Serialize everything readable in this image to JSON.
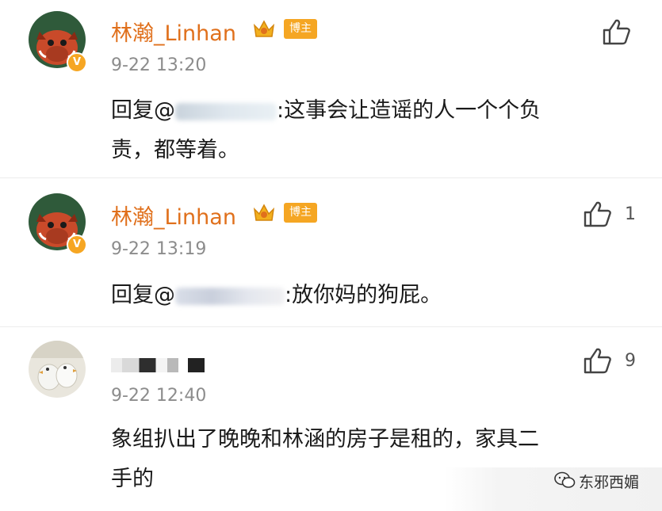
{
  "comments": [
    {
      "name": "林瀚_Linhan",
      "tag": "博主",
      "time": "9-22 13:20",
      "reply_prefix": "回复@",
      "text": ":这事会让造谣的人一个个负",
      "text2": "责，都等着。",
      "likes": ""
    },
    {
      "name": "林瀚_Linhan",
      "tag": "博主",
      "time": "9-22 13:19",
      "reply_prefix": "回复@",
      "text": ":放你妈的狗屁。",
      "likes": "1"
    },
    {
      "time": "9-22 12:40",
      "text": "象组扒出了晚晚和林涵的房子是租的，家具二",
      "text2": "手的",
      "likes": "9"
    }
  ],
  "watermark": "东邪西媚",
  "colors": {
    "name": "#e0701c",
    "tag_bg": "#f5a623",
    "time": "#8c8c8c",
    "vbadge": "#f6a623"
  },
  "icons": [
    "thumbs-up-icon",
    "crown-icon",
    "verified-v-icon",
    "wechat-icon"
  ]
}
